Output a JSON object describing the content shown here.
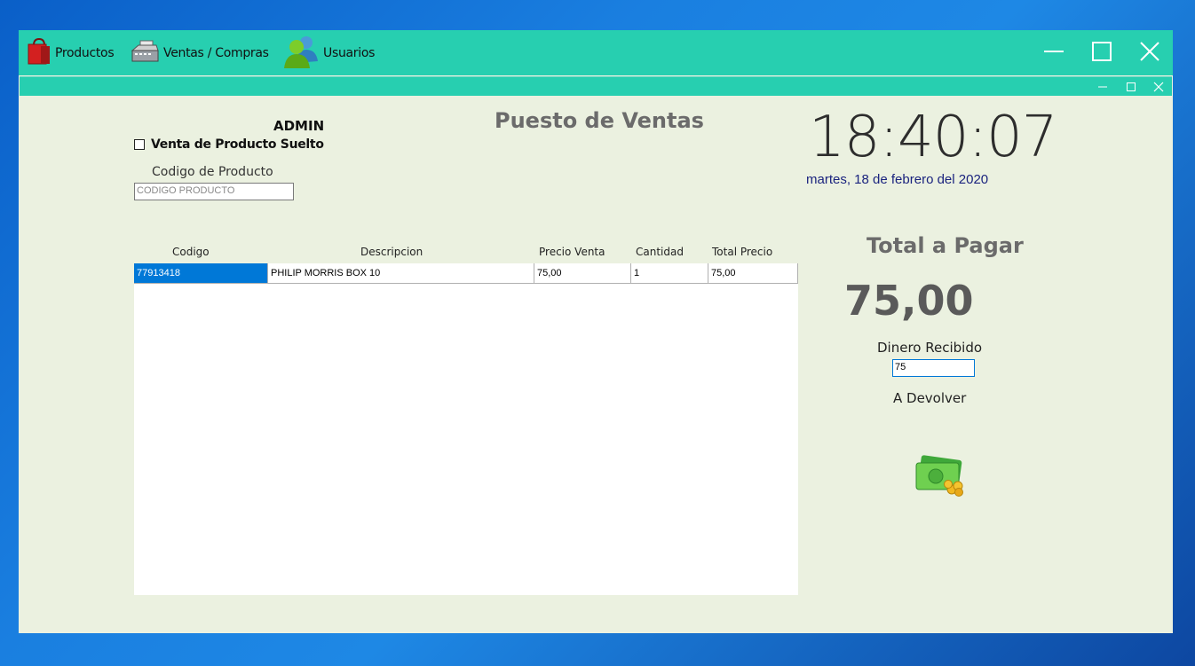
{
  "menubar": {
    "items": [
      {
        "label": "Productos",
        "icon": "shopping-bag-icon"
      },
      {
        "label": "Ventas / Compras",
        "icon": "cash-register-icon"
      },
      {
        "label": "Usuarios",
        "icon": "users-icon"
      }
    ]
  },
  "colors": {
    "accent": "#27cfb0",
    "background": "#ebf1e0",
    "selection": "#0078d7",
    "date_text": "#1a237e"
  },
  "main": {
    "user": "ADMIN",
    "loose_sale_label": "Venta de Producto Suelto",
    "product_code_label": "Codigo de Producto",
    "product_code_placeholder": "CODIGO PRODUCTO",
    "title": "Puesto de Ventas",
    "clock": "18:40:07",
    "date": "martes, 18 de febrero del 2020"
  },
  "grid": {
    "columns": [
      "Codigo",
      "Descripcion",
      "Precio Venta",
      "Cantidad",
      "Total Precio"
    ],
    "rows": [
      {
        "codigo": "77913418",
        "descripcion": "PHILIP MORRIS BOX 10",
        "precio": "75,00",
        "cantidad": "1",
        "total": "75,00"
      }
    ]
  },
  "payment": {
    "total_label": "Total a Pagar",
    "total_value": "75,00",
    "received_label": "Dinero Recibido",
    "received_value": "75",
    "change_label": "A Devolver"
  }
}
